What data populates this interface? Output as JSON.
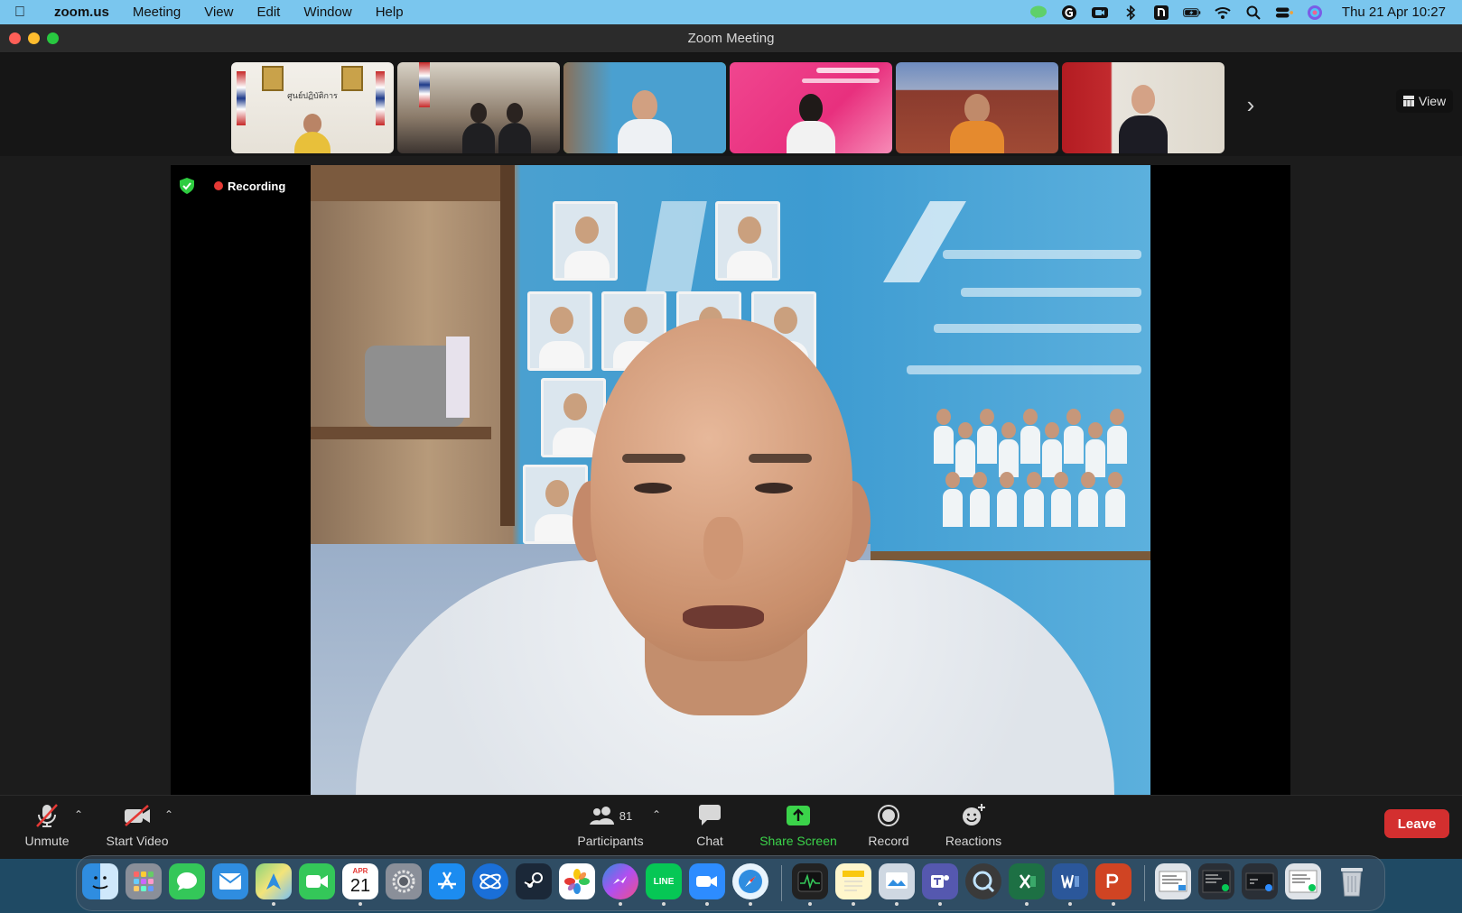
{
  "menubar": {
    "app_name": "zoom.us",
    "menus": [
      "Meeting",
      "View",
      "Edit",
      "Window",
      "Help"
    ],
    "clock": "Thu 21 Apr  10:27"
  },
  "window": {
    "title": "Zoom Meeting"
  },
  "strip": {
    "thumb1_label": "ศูนย์ปฏิบัติการ",
    "view_label": "View"
  },
  "video": {
    "recording_label": "Recording"
  },
  "toolbar": {
    "unmute_label": "Unmute",
    "start_video_label": "Start Video",
    "participants_label": "Participants",
    "participants_count": "81",
    "chat_label": "Chat",
    "share_screen_label": "Share Screen",
    "record_label": "Record",
    "reactions_label": "Reactions",
    "leave_label": "Leave"
  },
  "dock": {
    "calendar_month": "APR",
    "calendar_day": "21",
    "line_label": "LINE"
  },
  "colors": {
    "menubar": "#7ac6ee",
    "active_speaker": "#3bd34a",
    "share_screen": "#3bd34a",
    "leave": "#d32f2f",
    "recording_dot": "#e53935"
  }
}
